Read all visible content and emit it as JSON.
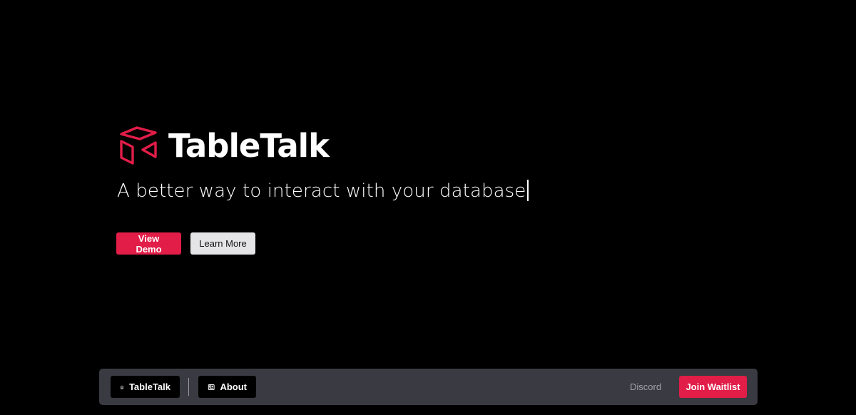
{
  "brand": {
    "name": "TableTalk",
    "logo_icon": "open-box-icon",
    "accent_color": "#e11d48"
  },
  "hero": {
    "tagline": "A better way to interact with your database",
    "primary_button": "View Demo",
    "secondary_button": "Learn More"
  },
  "dock": {
    "home_label": "TableTalk",
    "home_icon": "home-icon",
    "about_label": "About",
    "about_icon": "newspaper-icon",
    "discord_label": "Discord",
    "waitlist_label": "Join Waitlist"
  }
}
